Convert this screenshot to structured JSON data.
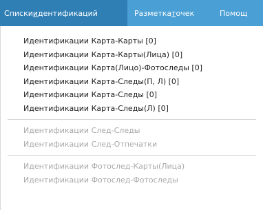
{
  "menubar": {
    "items": [
      {
        "label_pre": "Списки ",
        "label_underline": "и",
        "label_post": "дентификаций"
      },
      {
        "label_pre": "Разметка ",
        "label_underline": "т",
        "label_post": "очек"
      },
      {
        "label_pre": "Помощ",
        "label_underline": "",
        "label_post": ""
      }
    ]
  },
  "dropdown": {
    "group1": [
      "Идентификации Карта-Карты [0]",
      "Идентификации Карта-Карты(Лица) [0]",
      "Идентификации Карта(Лицо)-Фотоследы [0]",
      "Идентификации Карта-Следы(П, Л) [0]",
      "Идентификации Карта-Следы [0]",
      "Идентификации Карта-Следы(Л) [0]"
    ],
    "group2": [
      "Идентификации След-Следы",
      "Идентификации След-Отпечатки"
    ],
    "group3": [
      "Идентификации Фотослед-Карты(Лица)",
      "Идентификации Фотослед-Фотоследы"
    ]
  }
}
